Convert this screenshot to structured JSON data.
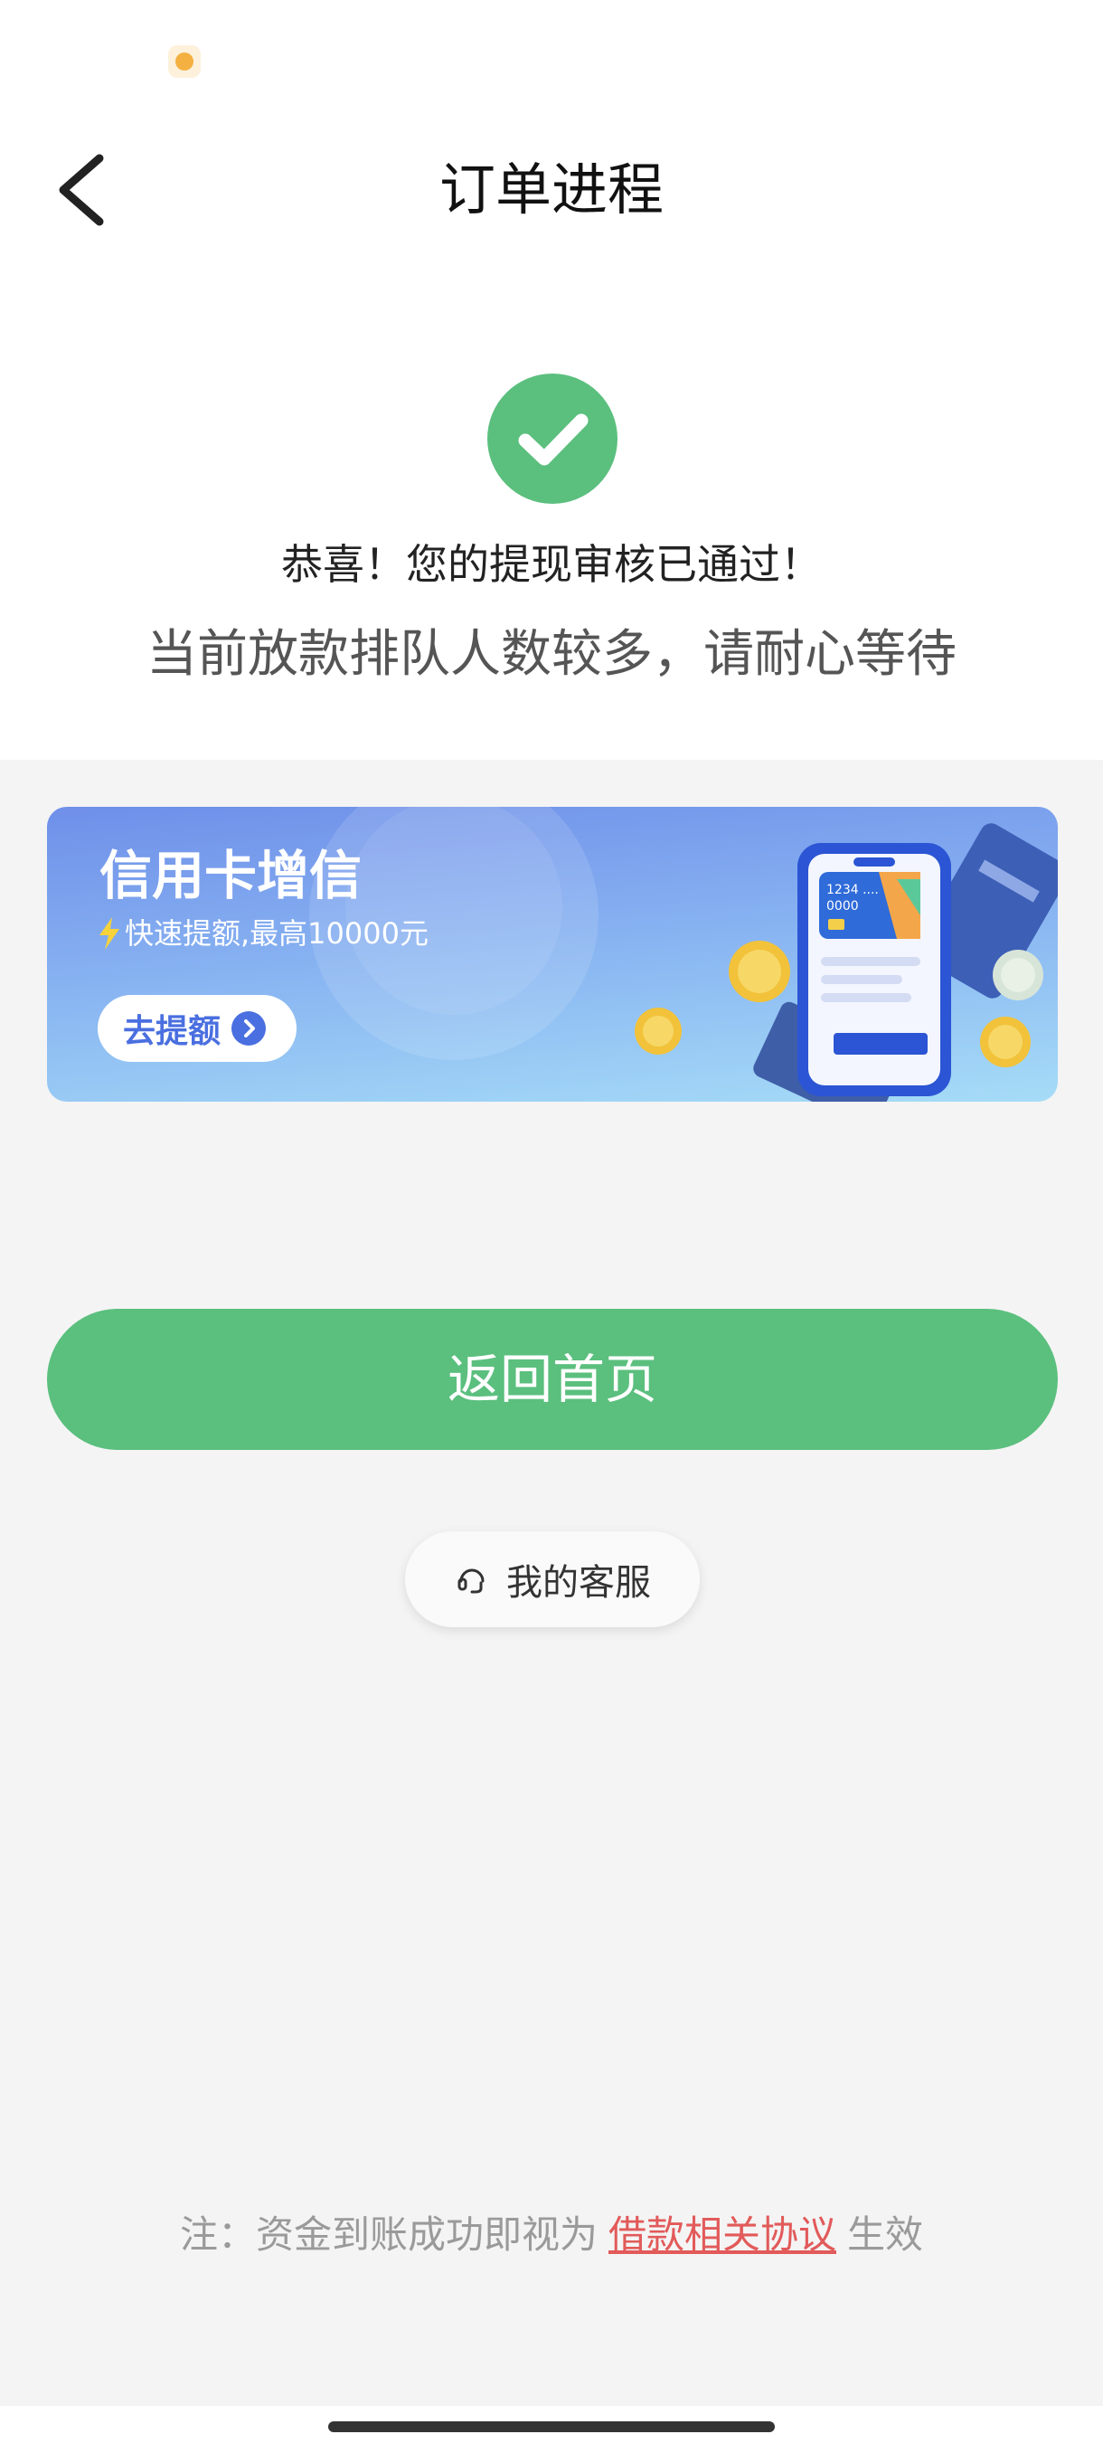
{
  "header": {
    "title": "订单进程",
    "back_icon": "chevron-left-icon"
  },
  "status": {
    "check_icon": "check-circle-icon",
    "success_color": "#5bbf7e",
    "message_primary": "恭喜！您的提现审核已通过！",
    "message_secondary": "当前放款排队人数较多，请耐心等待"
  },
  "banner": {
    "title": "信用卡增信",
    "subtitle": "快速提额,最高10000元",
    "button_label": "去提额",
    "card_text": "1234 ....\n0000"
  },
  "actions": {
    "home_button_label": "返回首页",
    "service_button_label": "我的客服"
  },
  "footer": {
    "note_prefix": "注：资金到账成功即视为",
    "note_link": "借款相关协议",
    "note_suffix": "生效",
    "link_color": "#e25a5a"
  }
}
